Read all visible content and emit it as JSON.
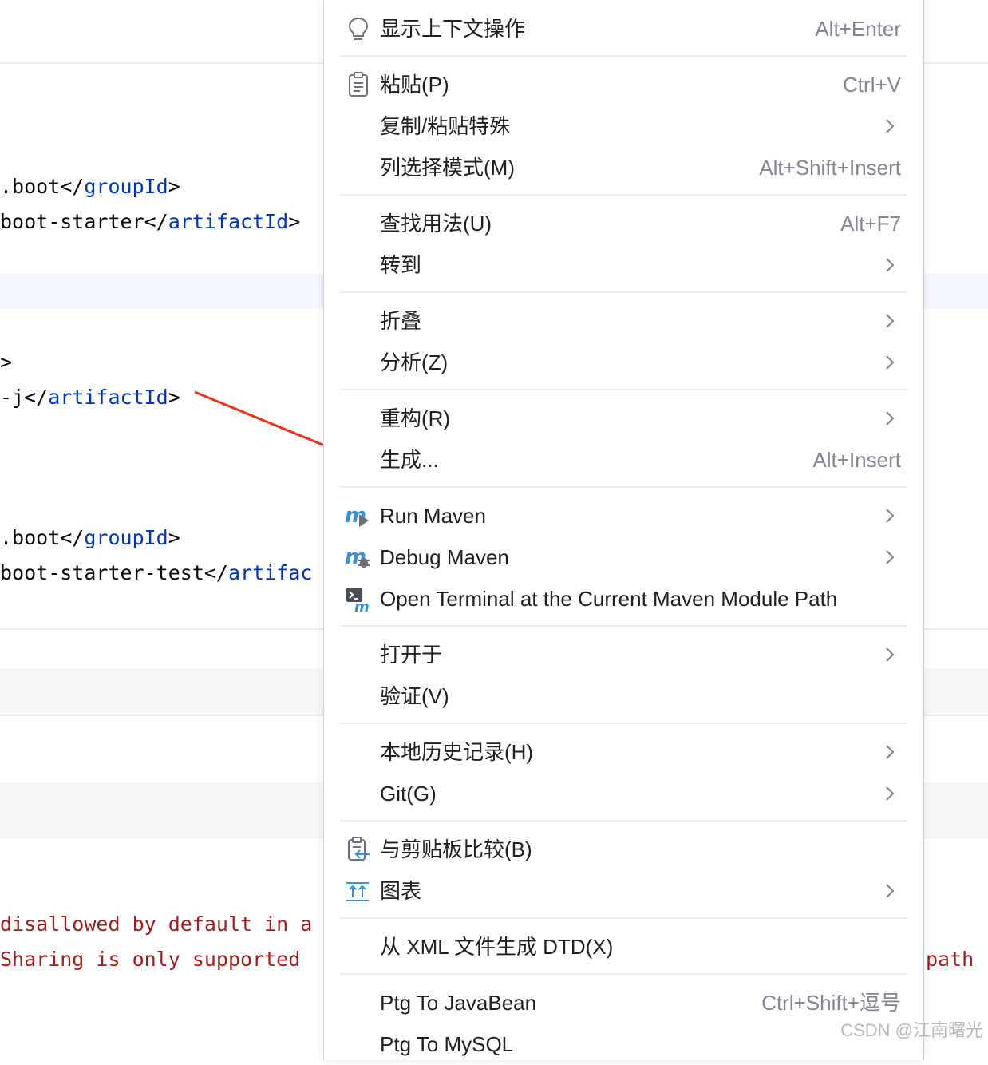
{
  "editor": {
    "code_lines": [
      {
        "plain": ".boot</",
        "tag": "groupId",
        "end": ">"
      },
      {
        "plain": "boot-starter</",
        "tag": "artifactId",
        "end": ">"
      },
      {
        "plain": ">",
        "tag": "",
        "end": ""
      },
      {
        "plain": "-j</",
        "tag": "artifactId",
        "end": ">"
      },
      {
        "plain": ".boot</",
        "tag": "groupId",
        "end": ">"
      },
      {
        "plain": "boot-starter-test</",
        "tag": "artifac",
        "end": ""
      }
    ],
    "console_lines": [
      "disallowed by default in a",
      "Sharing is only supported",
      "path"
    ]
  },
  "menu": {
    "items": [
      {
        "name": "show-context-actions",
        "label": "显示上下文操作",
        "shortcut": "Alt+Enter",
        "icon": "bulb-icon",
        "submenu": false
      },
      {
        "name": "paste",
        "label": "粘贴(P)",
        "shortcut": "Ctrl+V",
        "icon": "clipboard-icon",
        "submenu": false
      },
      {
        "name": "copy-paste-special",
        "label": "复制/粘贴特殊",
        "shortcut": "",
        "icon": "",
        "submenu": true
      },
      {
        "name": "column-selection-mode",
        "label": "列选择模式(M)",
        "shortcut": "Alt+Shift+Insert",
        "icon": "",
        "submenu": false
      },
      {
        "name": "find-usages",
        "label": "查找用法(U)",
        "shortcut": "Alt+F7",
        "icon": "",
        "submenu": false
      },
      {
        "name": "goto",
        "label": "转到",
        "shortcut": "",
        "icon": "",
        "submenu": true
      },
      {
        "name": "folding",
        "label": "折叠",
        "shortcut": "",
        "icon": "",
        "submenu": true
      },
      {
        "name": "analyze",
        "label": "分析(Z)",
        "shortcut": "",
        "icon": "",
        "submenu": true
      },
      {
        "name": "refactor",
        "label": "重构(R)",
        "shortcut": "",
        "icon": "",
        "submenu": true
      },
      {
        "name": "generate",
        "label": "生成...",
        "shortcut": "Alt+Insert",
        "icon": "",
        "submenu": false
      },
      {
        "name": "run-maven",
        "label": "Run Maven",
        "shortcut": "",
        "icon": "maven-run-icon",
        "submenu": true
      },
      {
        "name": "debug-maven",
        "label": "Debug Maven",
        "shortcut": "",
        "icon": "maven-debug-icon",
        "submenu": true
      },
      {
        "name": "open-terminal-maven",
        "label": "Open Terminal at the Current Maven Module Path",
        "shortcut": "",
        "icon": "maven-terminal-icon",
        "submenu": false
      },
      {
        "name": "open-in",
        "label": "打开于",
        "shortcut": "",
        "icon": "",
        "submenu": true
      },
      {
        "name": "validate",
        "label": "验证(V)",
        "shortcut": "",
        "icon": "",
        "submenu": false
      },
      {
        "name": "local-history",
        "label": "本地历史记录(H)",
        "shortcut": "",
        "icon": "",
        "submenu": true
      },
      {
        "name": "git",
        "label": "Git(G)",
        "shortcut": "",
        "icon": "",
        "submenu": true
      },
      {
        "name": "compare-with-clipboard",
        "label": "与剪贴板比较(B)",
        "shortcut": "",
        "icon": "compare-clipboard-icon",
        "submenu": false
      },
      {
        "name": "diagrams",
        "label": "图表",
        "shortcut": "",
        "icon": "diagram-icon",
        "submenu": true
      },
      {
        "name": "generate-dtd",
        "label": "从 XML 文件生成 DTD(X)",
        "shortcut": "",
        "icon": "",
        "submenu": false
      },
      {
        "name": "ptg-to-javabean",
        "label": "Ptg To JavaBean",
        "shortcut": "Ctrl+Shift+逗号",
        "icon": "",
        "submenu": false
      },
      {
        "name": "ptg-to-mysql",
        "label": "Ptg To MySQL",
        "shortcut": "",
        "icon": "",
        "submenu": false
      }
    ]
  },
  "watermark": "CSDN @江南曙光",
  "colors": {
    "accent_arrow": "#e8321c",
    "tag": "#0033b3",
    "console_error": "#9c1f1f",
    "shortcut": "#818594"
  }
}
